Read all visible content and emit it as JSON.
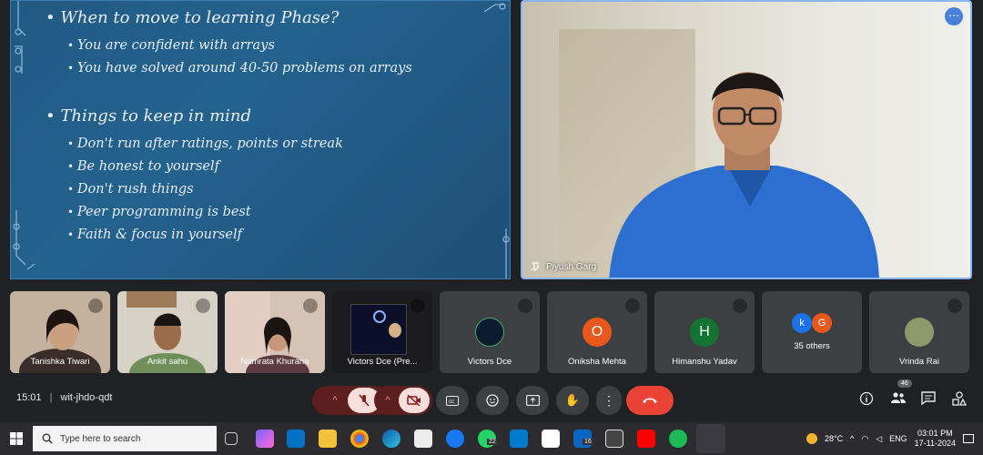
{
  "slide": {
    "heading1": "When to move to learning Phase?",
    "list1": [
      "You are confident with arrays",
      "You have solved around 40-50 problems on arrays"
    ],
    "heading2": "Things to keep in mind",
    "list2": [
      "Don't run after ratings, points or streak",
      "Be honest to yourself",
      "Don't rush things",
      "Peer programming is best",
      "Faith & focus in yourself"
    ]
  },
  "speaker": {
    "name": "Piyush Garg",
    "more_icon": "more-options-icon"
  },
  "participants": [
    {
      "name": "Tanishka Tiwari"
    },
    {
      "name": "Ankit sahu"
    },
    {
      "name": "Namrata Khurana"
    },
    {
      "name": "Victors Dce (Pre..."
    },
    {
      "name": "Victors Dce"
    },
    {
      "name": "Oniksha Mehta",
      "initial": "O",
      "color": "#e8581c"
    },
    {
      "name": "Himanshu Yadav",
      "initial": "H",
      "color": "#137333"
    },
    {
      "name": "35 others",
      "initials": [
        "k",
        "G"
      ],
      "colors": [
        "#1a73e8",
        "#e8581c"
      ]
    },
    {
      "name": "Vrinda Rai"
    }
  ],
  "meeting": {
    "time": "15:01",
    "code": "wit-jhdo-qdt",
    "people_count": "46",
    "end_color": "#ea4335"
  },
  "taskbar": {
    "search_placeholder": "Type here to search",
    "whatsapp_badge": "22",
    "linkedin_badge": "16",
    "weather": "28°C",
    "lang": "ENG",
    "clock_time": "03:01 PM",
    "clock_date": "17-11-2024"
  }
}
